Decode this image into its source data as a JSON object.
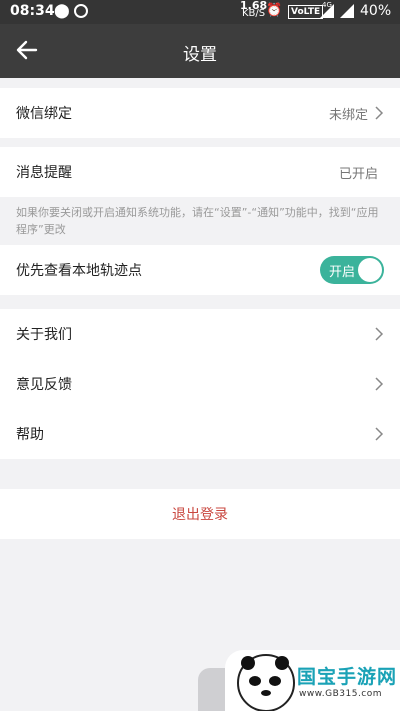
{
  "status_bar": {
    "time": "08:34",
    "net_speed": "1.68",
    "net_unit": "KB/S",
    "volte": "VoLTE",
    "network": "4G",
    "battery": "40%"
  },
  "app_bar": {
    "title": "设置",
    "back_icon": "arrow-left-icon"
  },
  "settings": {
    "wechat": {
      "label": "微信绑定",
      "value": "未绑定"
    },
    "notification": {
      "label": "消息提醒",
      "value": "已开启"
    },
    "notification_hint": "如果你要关闭或开启通知系统功能，请在“设置”-“通知”功能中，找到“应用程序”更改",
    "local_points": {
      "label": "优先查看本地轨迹点",
      "toggle_text": "开启",
      "on": true
    },
    "about": {
      "label": "关于我们"
    },
    "feedback": {
      "label": "意见反馈"
    },
    "help": {
      "label": "帮助"
    }
  },
  "logout": {
    "label": "退出登录"
  },
  "watermark": {
    "brand": "国宝手游网",
    "url": "www.GB315.com"
  },
  "colors": {
    "app_bar": "#3d3d3d",
    "toggle_on": "#3bb39b",
    "logout_text": "#c9473f",
    "background": "#f2f2f4"
  }
}
